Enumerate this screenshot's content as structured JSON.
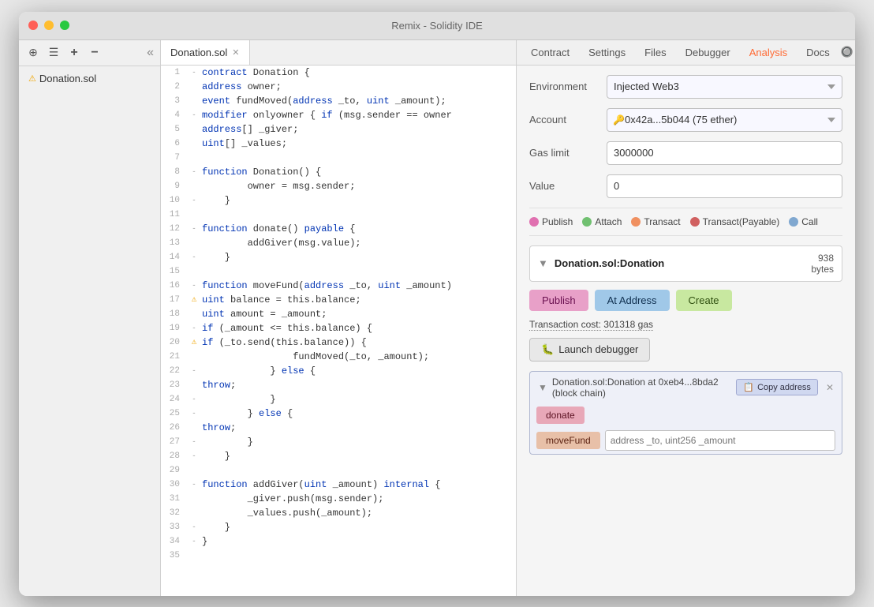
{
  "window": {
    "title": "Remix - Solidity IDE"
  },
  "sidebar": {
    "file": "Donation.sol",
    "collapse_icon": "«",
    "icons": [
      "⊕",
      "☰",
      "+",
      "−"
    ]
  },
  "editor": {
    "tab_name": "Donation.sol",
    "lines": [
      {
        "num": 1,
        "indent": 0,
        "fold": "-",
        "warn": "",
        "content": "contract Donation {",
        "tokens": [
          {
            "t": "kw",
            "v": "contract"
          },
          {
            "t": "",
            "v": " Donation {"
          }
        ]
      },
      {
        "num": 2,
        "indent": 1,
        "fold": "",
        "warn": "",
        "content": "    address owner;",
        "tokens": [
          {
            "t": "type",
            "v": "address"
          },
          {
            "t": "",
            "v": " owner;"
          }
        ]
      },
      {
        "num": 3,
        "indent": 1,
        "fold": "",
        "warn": "",
        "content": "    event fundMoved(address _to, uint _amount);",
        "tokens": [
          {
            "t": "kw",
            "v": "event"
          },
          {
            "t": "",
            "v": " fundMoved("
          },
          {
            "t": "type",
            "v": "address"
          },
          {
            "t": "",
            "v": " _to, "
          },
          {
            "t": "type",
            "v": "uint"
          },
          {
            "t": "",
            "v": " _amount);"
          }
        ]
      },
      {
        "num": 4,
        "indent": 1,
        "fold": "-",
        "warn": "",
        "content": "    modifier onlyowner { if (msg.sender == owner",
        "tokens": [
          {
            "t": "kw",
            "v": "modifier"
          },
          {
            "t": "",
            "v": " onlyowner { "
          },
          {
            "t": "kw",
            "v": "if"
          },
          {
            "t": "",
            "v": " (msg.sender == owner"
          }
        ]
      },
      {
        "num": 5,
        "indent": 1,
        "fold": "",
        "warn": "",
        "content": "    address[] _giver;",
        "tokens": [
          {
            "t": "type",
            "v": "address"
          },
          {
            "t": "",
            "v": "[] _giver;"
          }
        ]
      },
      {
        "num": 6,
        "indent": 1,
        "fold": "",
        "warn": "",
        "content": "    uint[] _values;",
        "tokens": [
          {
            "t": "type",
            "v": "uint"
          },
          {
            "t": "",
            "v": "[] _values;"
          }
        ]
      },
      {
        "num": 7,
        "indent": 0,
        "fold": "",
        "warn": "",
        "content": "",
        "tokens": []
      },
      {
        "num": 8,
        "indent": 1,
        "fold": "-",
        "warn": "",
        "content": "    function Donation() {",
        "tokens": [
          {
            "t": "kw",
            "v": "function"
          },
          {
            "t": "",
            "v": " Donation() {"
          }
        ]
      },
      {
        "num": 9,
        "indent": 2,
        "fold": "",
        "warn": "",
        "content": "        owner = msg.sender;",
        "tokens": [
          {
            "t": "",
            "v": "        owner = msg.sender;"
          }
        ]
      },
      {
        "num": 10,
        "indent": 1,
        "fold": "-",
        "warn": "",
        "content": "    }",
        "tokens": [
          {
            "t": "",
            "v": "    }"
          }
        ]
      },
      {
        "num": 11,
        "indent": 0,
        "fold": "",
        "warn": "",
        "content": "",
        "tokens": []
      },
      {
        "num": 12,
        "indent": 1,
        "fold": "-",
        "warn": "",
        "content": "    function donate() payable {",
        "tokens": [
          {
            "t": "kw",
            "v": "function"
          },
          {
            "t": "",
            "v": " donate() "
          },
          {
            "t": "kw",
            "v": "payable"
          },
          {
            "t": "",
            "v": " {"
          }
        ]
      },
      {
        "num": 13,
        "indent": 2,
        "fold": "",
        "warn": "",
        "content": "        addGiver(msg.value);",
        "tokens": [
          {
            "t": "",
            "v": "        addGiver(msg.value);"
          }
        ]
      },
      {
        "num": 14,
        "indent": 1,
        "fold": "-",
        "warn": "",
        "content": "    }",
        "tokens": [
          {
            "t": "",
            "v": "    }"
          }
        ]
      },
      {
        "num": 15,
        "indent": 0,
        "fold": "",
        "warn": "",
        "content": "",
        "tokens": []
      },
      {
        "num": 16,
        "indent": 1,
        "fold": "-",
        "warn": "",
        "content": "    function moveFund(address _to, uint _amount)",
        "tokens": [
          {
            "t": "kw",
            "v": "function"
          },
          {
            "t": "",
            "v": " moveFund("
          },
          {
            "t": "type",
            "v": "address"
          },
          {
            "t": "",
            "v": " _to, "
          },
          {
            "t": "type",
            "v": "uint"
          },
          {
            "t": "",
            "v": " _amount)"
          }
        ]
      },
      {
        "num": 17,
        "indent": 2,
        "fold": "",
        "warn": "⚠",
        "content": "        uint balance = this.balance;",
        "tokens": [
          {
            "t": "type",
            "v": "uint"
          },
          {
            "t": "",
            "v": " balance = this.balance;"
          }
        ]
      },
      {
        "num": 18,
        "indent": 2,
        "fold": "",
        "warn": "",
        "content": "        uint amount = _amount;",
        "tokens": [
          {
            "t": "type",
            "v": "uint"
          },
          {
            "t": "",
            "v": " amount = _amount;"
          }
        ]
      },
      {
        "num": 19,
        "indent": 2,
        "fold": "-",
        "warn": "",
        "content": "        if (_amount <= this.balance) {",
        "tokens": [
          {
            "t": "kw",
            "v": "if"
          },
          {
            "t": "",
            "v": " (_amount <= this.balance) {"
          }
        ]
      },
      {
        "num": 20,
        "indent": 3,
        "fold": "-",
        "warn": "⚠",
        "content": "            if (_to.send(this.balance)) {",
        "tokens": [
          {
            "t": "kw",
            "v": "if"
          },
          {
            "t": "",
            "v": " (_to.send(this.balance)) {"
          }
        ]
      },
      {
        "num": 21,
        "indent": 4,
        "fold": "",
        "warn": "",
        "content": "                fundMoved(_to, _amount);",
        "tokens": [
          {
            "t": "",
            "v": "                fundMoved(_to, _amount);"
          }
        ]
      },
      {
        "num": 22,
        "indent": 3,
        "fold": "-",
        "warn": "",
        "content": "            } else {",
        "tokens": [
          {
            "t": "",
            "v": "            } "
          },
          {
            "t": "kw",
            "v": "else"
          },
          {
            "t": "",
            "v": " {"
          }
        ]
      },
      {
        "num": 23,
        "indent": 4,
        "fold": "",
        "warn": "",
        "content": "                throw;",
        "tokens": [
          {
            "t": "kw",
            "v": "throw"
          },
          {
            "t": "",
            "v": ";"
          }
        ]
      },
      {
        "num": 24,
        "indent": 3,
        "fold": "-",
        "warn": "",
        "content": "            }",
        "tokens": [
          {
            "t": "",
            "v": "            }"
          }
        ]
      },
      {
        "num": 25,
        "indent": 2,
        "fold": "-",
        "warn": "",
        "content": "        } else {",
        "tokens": [
          {
            "t": "",
            "v": "        } "
          },
          {
            "t": "kw",
            "v": "else"
          },
          {
            "t": "",
            "v": " {"
          }
        ]
      },
      {
        "num": 26,
        "indent": 3,
        "fold": "",
        "warn": "",
        "content": "            throw;",
        "tokens": [
          {
            "t": "kw",
            "v": "throw"
          },
          {
            "t": "",
            "v": ";"
          }
        ]
      },
      {
        "num": 27,
        "indent": 2,
        "fold": "-",
        "warn": "",
        "content": "        }",
        "tokens": [
          {
            "t": "",
            "v": "        }"
          }
        ]
      },
      {
        "num": 28,
        "indent": 1,
        "fold": "-",
        "warn": "",
        "content": "    }",
        "tokens": [
          {
            "t": "",
            "v": "    }"
          }
        ]
      },
      {
        "num": 29,
        "indent": 0,
        "fold": "",
        "warn": "",
        "content": "",
        "tokens": []
      },
      {
        "num": 30,
        "indent": 1,
        "fold": "-",
        "warn": "",
        "content": "    function addGiver(uint _amount) internal {",
        "tokens": [
          {
            "t": "kw",
            "v": "function"
          },
          {
            "t": "",
            "v": " addGiver("
          },
          {
            "t": "type",
            "v": "uint"
          },
          {
            "t": "",
            "v": " _amount) "
          },
          {
            "t": "kw",
            "v": "internal"
          },
          {
            "t": "",
            "v": " {"
          }
        ]
      },
      {
        "num": 31,
        "indent": 2,
        "fold": "",
        "warn": "",
        "content": "        _giver.push(msg.sender);",
        "tokens": [
          {
            "t": "",
            "v": "        _giver.push(msg.sender);"
          }
        ]
      },
      {
        "num": 32,
        "indent": 2,
        "fold": "",
        "warn": "",
        "content": "        _values.push(_amount);",
        "tokens": [
          {
            "t": "",
            "v": "        _values.push(_amount);"
          }
        ]
      },
      {
        "num": 33,
        "indent": 1,
        "fold": "-",
        "warn": "",
        "content": "    }",
        "tokens": [
          {
            "t": "",
            "v": "    }"
          }
        ]
      },
      {
        "num": 34,
        "indent": 0,
        "fold": "-",
        "warn": "",
        "content": "}",
        "tokens": [
          {
            "t": "",
            "v": "}"
          }
        ]
      },
      {
        "num": 35,
        "indent": 0,
        "fold": "",
        "warn": "",
        "content": "",
        "tokens": []
      }
    ]
  },
  "right_panel": {
    "tabs": [
      {
        "id": "contract",
        "label": "Contract",
        "active": false
      },
      {
        "id": "settings",
        "label": "Settings",
        "active": false
      },
      {
        "id": "files",
        "label": "Files",
        "active": false
      },
      {
        "id": "debugger",
        "label": "Debugger",
        "active": false
      },
      {
        "id": "analysis",
        "label": "Analysis",
        "active": true
      },
      {
        "id": "docs",
        "label": "Docs",
        "active": false
      }
    ],
    "environment": {
      "label": "Environment",
      "value": "Injected Web3"
    },
    "account": {
      "label": "Account",
      "value": "0x42a...5b044 (75 ether)"
    },
    "gas_limit": {
      "label": "Gas limit",
      "value": "3000000"
    },
    "value_field": {
      "label": "Value",
      "value": "0"
    },
    "legend": [
      {
        "id": "publish",
        "color": "#e8a0c8",
        "label": "Publish"
      },
      {
        "id": "attach",
        "color": "#a0d0a0",
        "label": "Attach"
      },
      {
        "id": "transact",
        "color": "#f0b090",
        "label": "Transact"
      },
      {
        "id": "transact-payable",
        "color": "#e08080",
        "label": "Transact(Payable)"
      },
      {
        "id": "call",
        "color": "#a0c0e0",
        "label": "Call"
      }
    ],
    "contract_section": {
      "name": "Donation.sol:Donation",
      "size": "938",
      "size_unit": "bytes",
      "actions": {
        "publish": "Publish",
        "at_address": "At Address",
        "create": "Create"
      },
      "transaction_cost": "Transaction cost:",
      "transaction_gas": "301318 gas",
      "debugger_btn": "Launch debugger"
    },
    "deployed": {
      "title": "Donation.sol:Donation at 0xeb4...8bda2 (block chain)",
      "copy_label": "Copy address",
      "functions": [
        {
          "id": "donate",
          "label": "donate",
          "type": "donate",
          "has_input": false
        },
        {
          "id": "moveFund",
          "label": "moveFund",
          "type": "movefund",
          "has_input": true,
          "placeholder": "address _to, uint256 _amount"
        }
      ]
    }
  }
}
